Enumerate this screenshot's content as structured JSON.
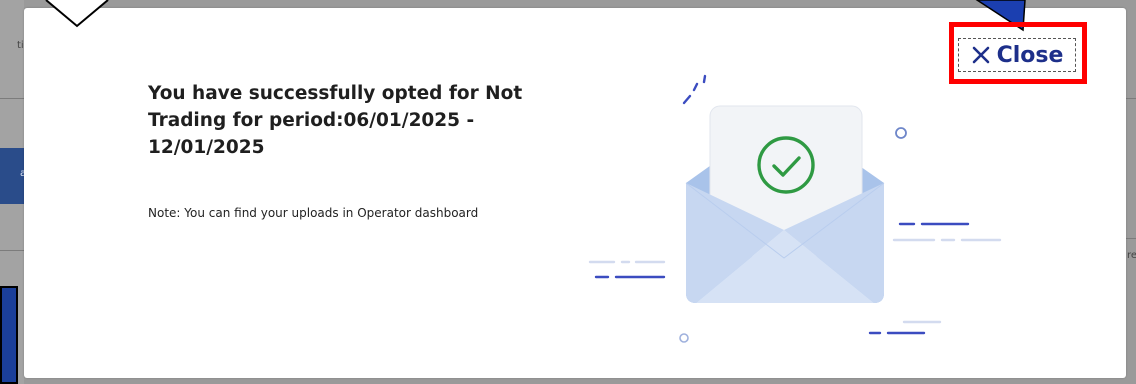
{
  "background": {
    "left_chars": [
      "ti",
      "a"
    ],
    "right_char": "re"
  },
  "modal": {
    "message": "You have successfully opted for Not Trading for period:06/01/2025 - 12/01/2025",
    "note": "Note: You can find your uploads in Operator dashboard",
    "close_label": "Close",
    "close_icon": "close-x-icon",
    "illustration": "envelope-success-icon"
  },
  "colors": {
    "close_text": "#1d2f8a",
    "highlight": "#ff0000",
    "check_green": "#2f9a43",
    "envelope_light": "#d6e2f5",
    "envelope_mid": "#a9c3ea",
    "dash_blue": "#3b4cc0"
  }
}
